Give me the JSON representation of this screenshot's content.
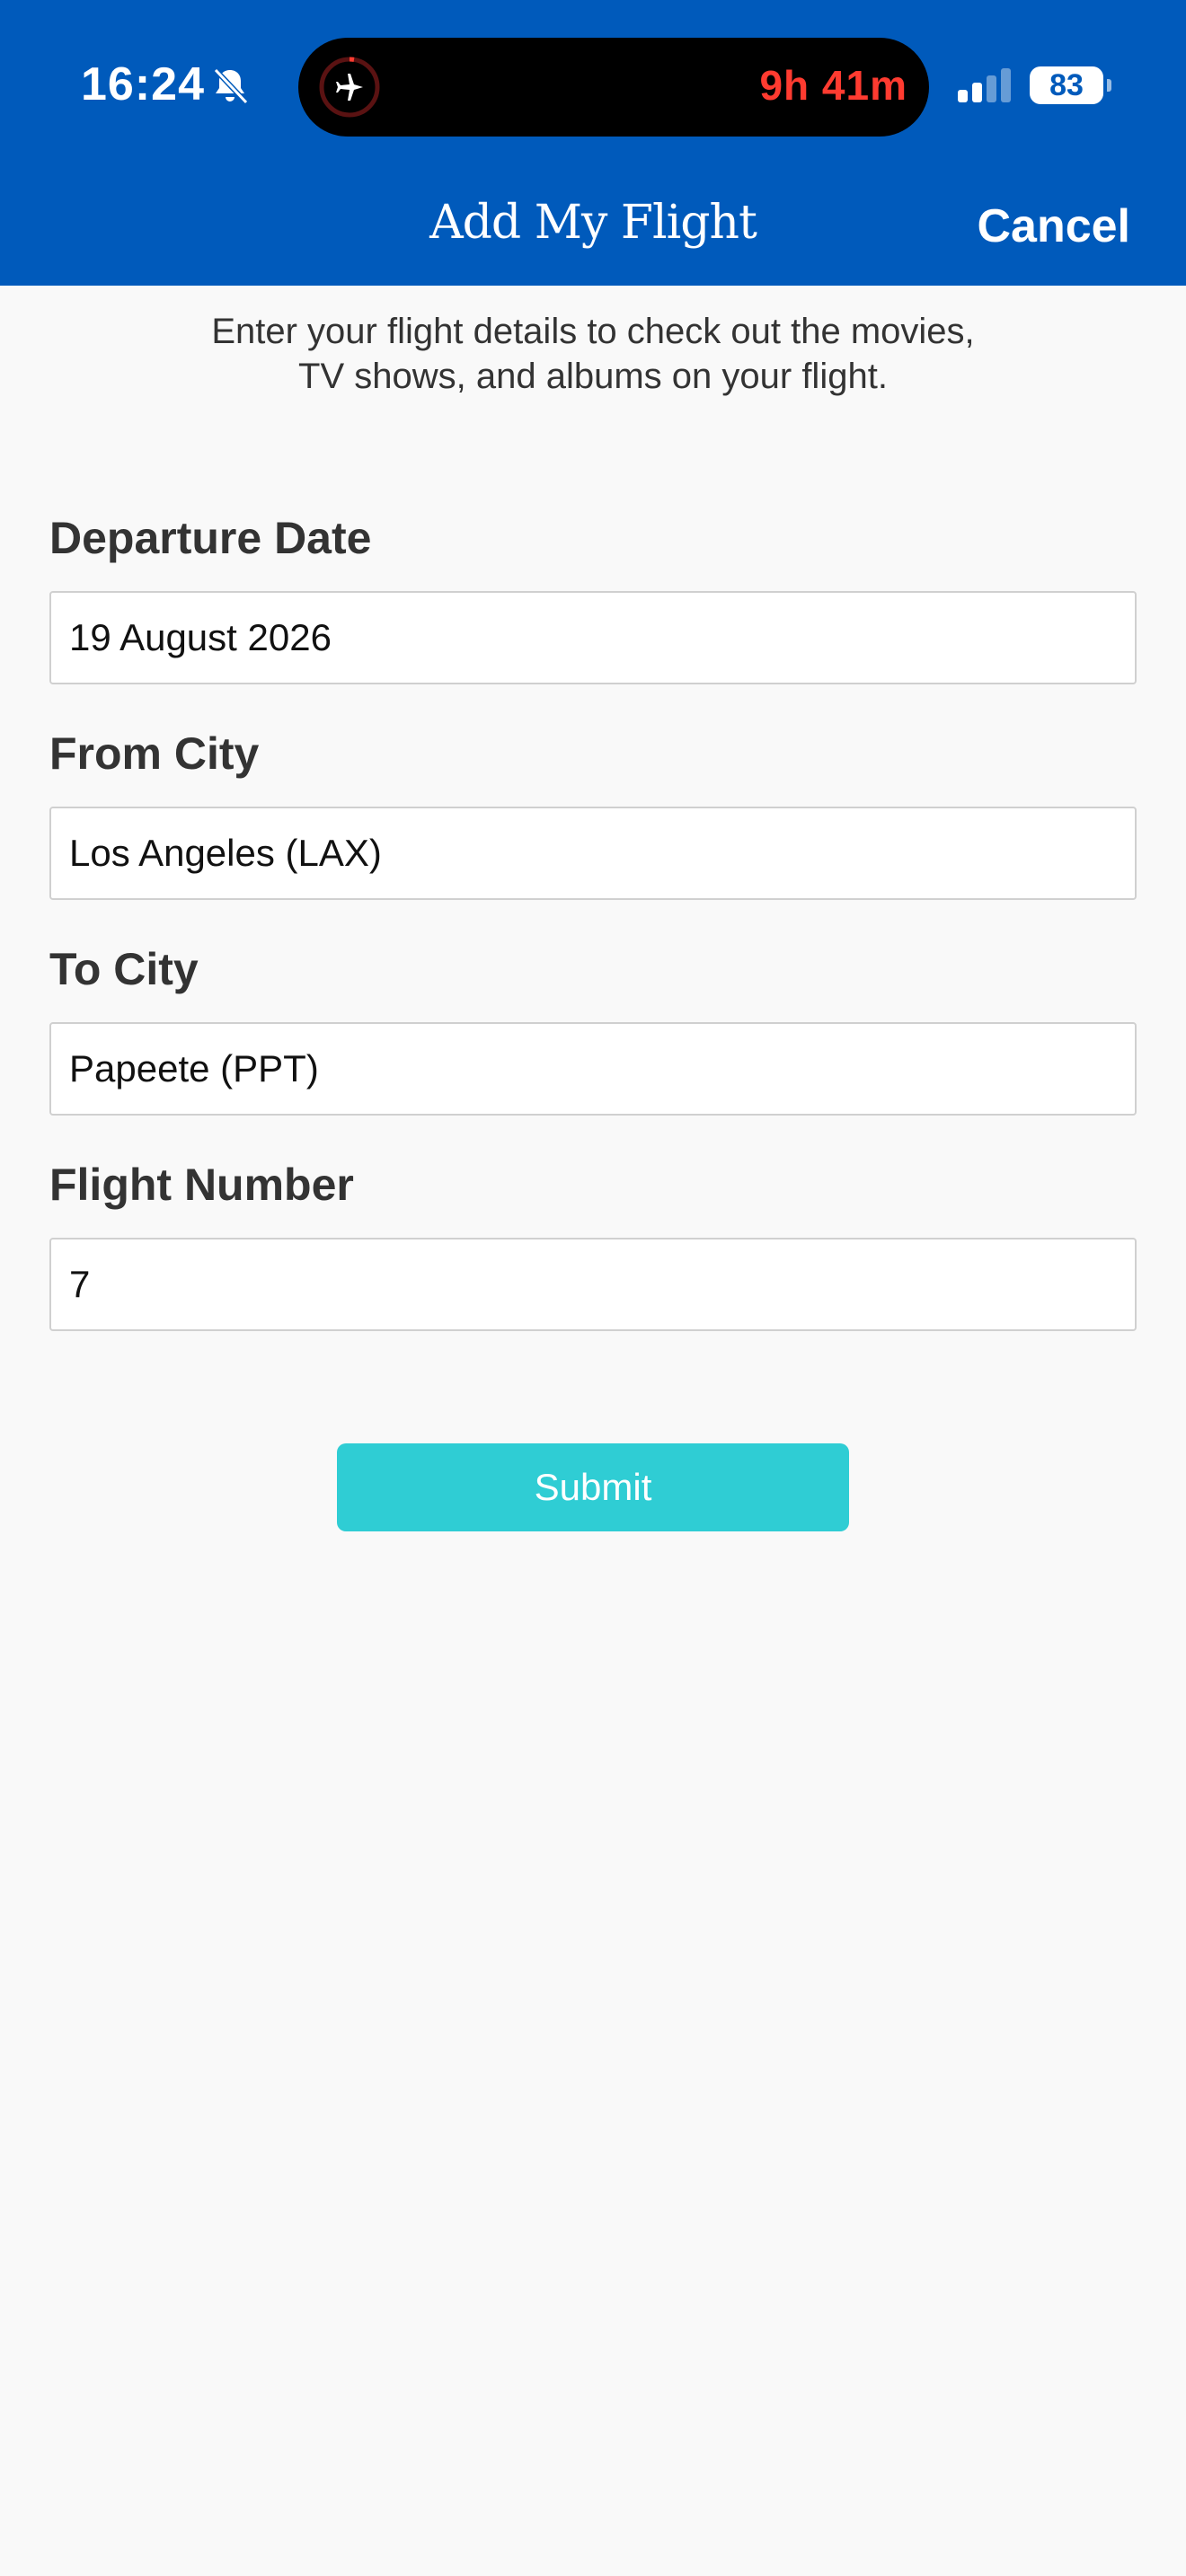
{
  "status_bar": {
    "time": "16:24",
    "timer": "9h 41m",
    "battery": "83",
    "battery_level": 0.83,
    "icons": [
      "bell-slash-icon",
      "airplane-icon",
      "signal-icon",
      "battery-icon"
    ]
  },
  "nav": {
    "title": "Add My Flight",
    "cancel_label": "Cancel"
  },
  "intro": {
    "line1": "Enter your flight details to check out the movies,",
    "line2": "TV shows, and albums on your flight."
  },
  "form": {
    "departure_date": {
      "label": "Departure Date",
      "value": "19 August 2026"
    },
    "from_city": {
      "label": "From City",
      "value": "Los Angeles (LAX)"
    },
    "to_city": {
      "label": "To City",
      "value": "Papeete (PPT)"
    },
    "flight_number": {
      "label": "Flight Number",
      "value": "7"
    },
    "submit_label": "Submit"
  },
  "colors": {
    "header_bg": "#005abb",
    "page_bg": "#f9f9f9",
    "submit_bg": "#2fcdd4",
    "timer_red": "#ff3b30"
  }
}
